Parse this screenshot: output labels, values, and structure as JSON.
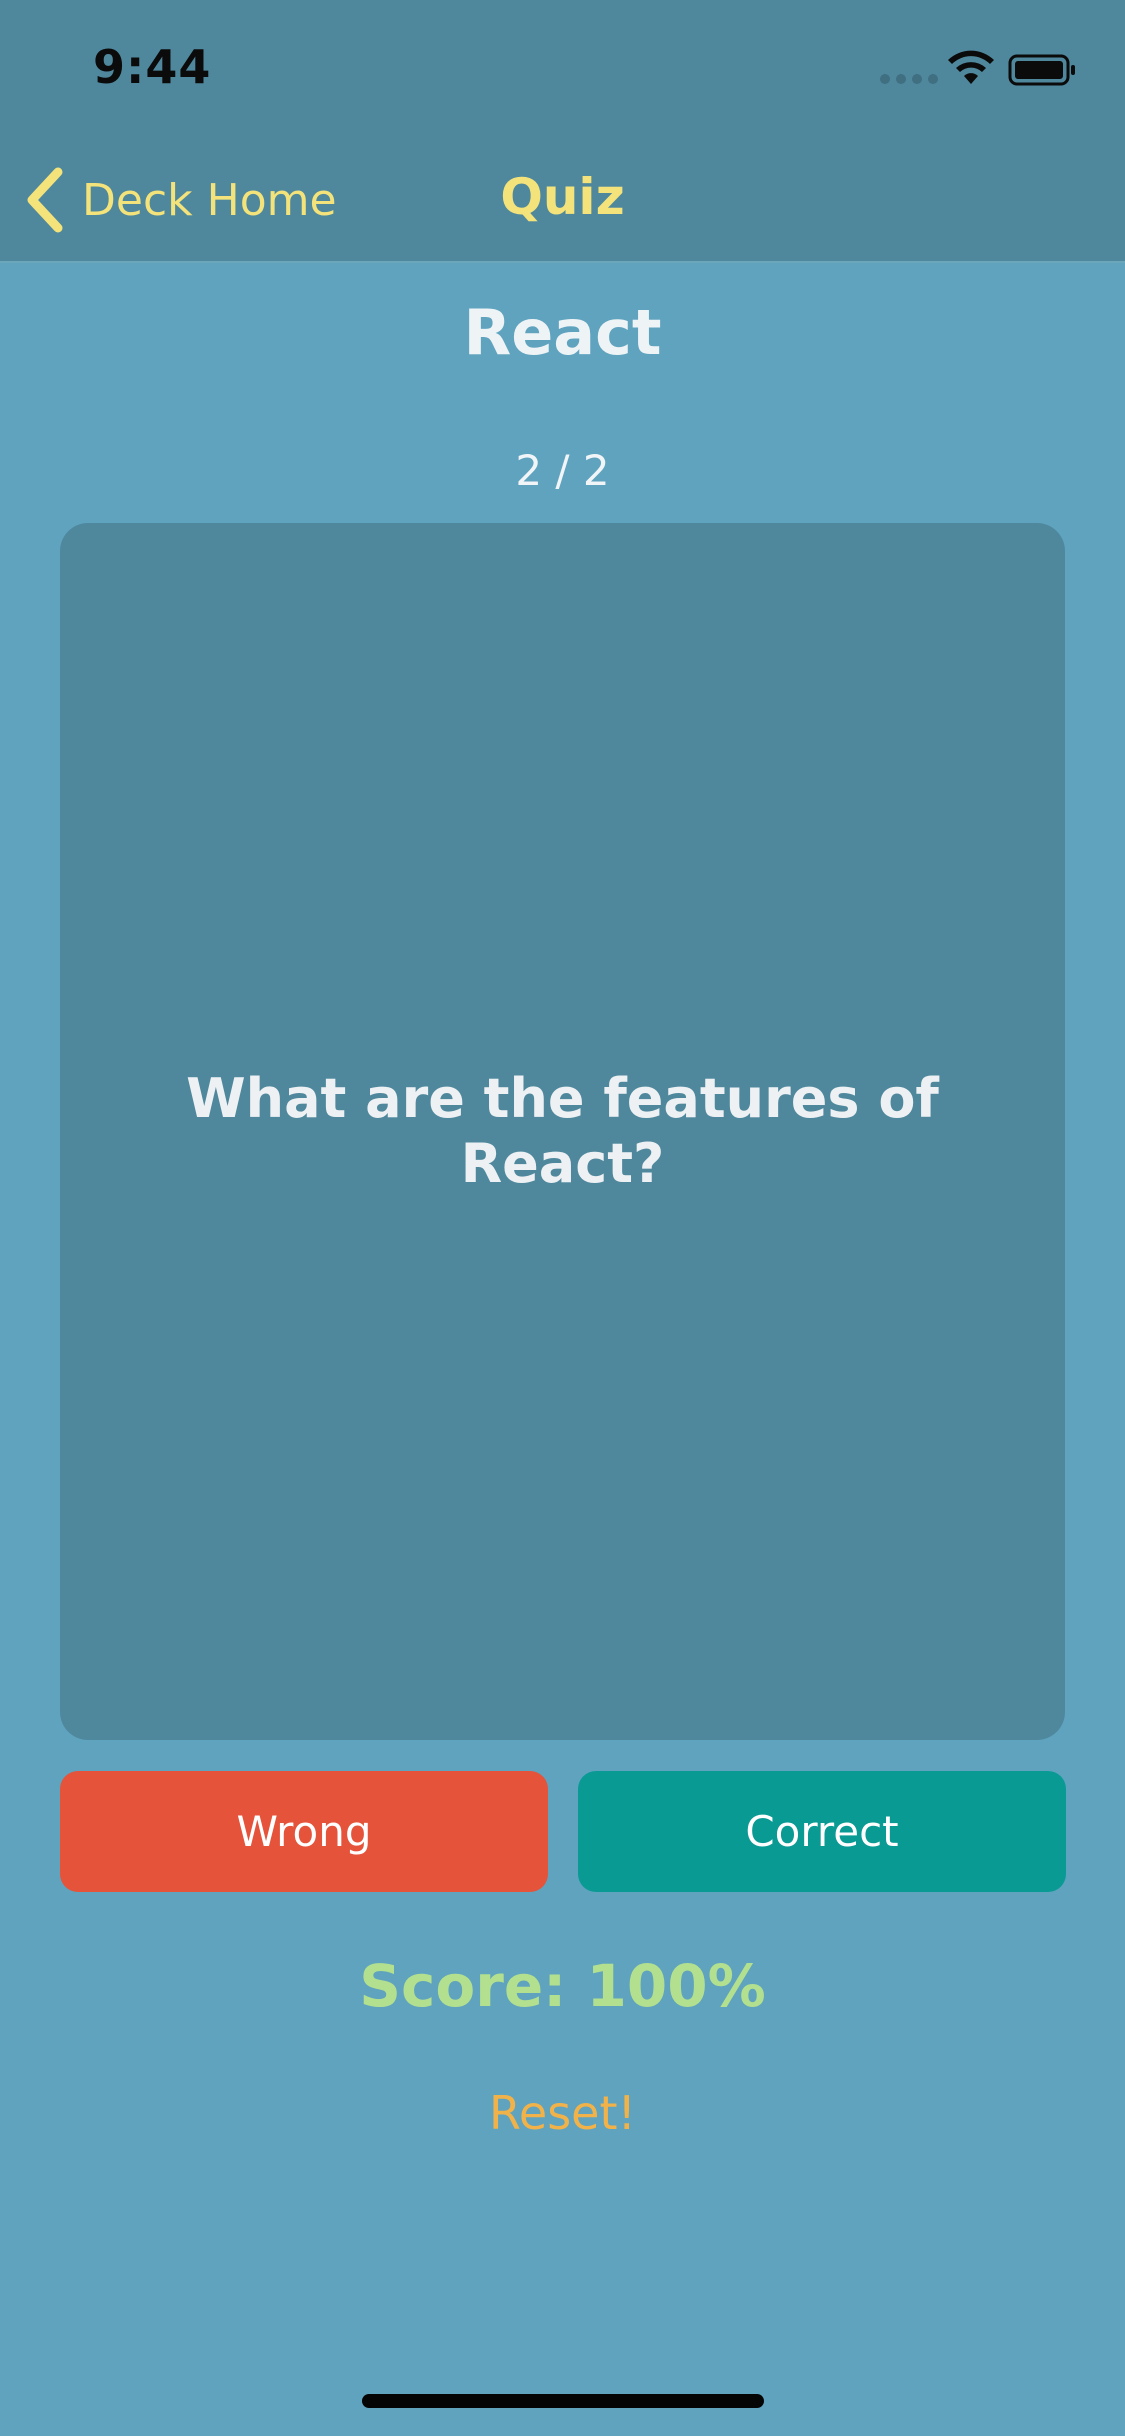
{
  "status_bar": {
    "time": "9:44"
  },
  "nav": {
    "back_label": "Deck Home",
    "title": "Quiz"
  },
  "deck": {
    "title": "React"
  },
  "quiz": {
    "progress": "2 / 2",
    "question": "What are the features of React?",
    "wrong_label": "Wrong",
    "correct_label": "Correct",
    "score": "Score: 100%",
    "reset_label": "Reset!"
  },
  "colors": {
    "background": "#5fa3bf",
    "header": "#4f889d",
    "accent_yellow": "#f4e37a",
    "wrong": "#e5533a",
    "correct": "#0a9a94",
    "score": "#b3e08e",
    "reset": "#f1b24a"
  },
  "icons": {
    "back": "chevron-left-icon",
    "wifi": "wifi-icon",
    "battery": "battery-icon",
    "signal": "signal-dots-icon"
  }
}
